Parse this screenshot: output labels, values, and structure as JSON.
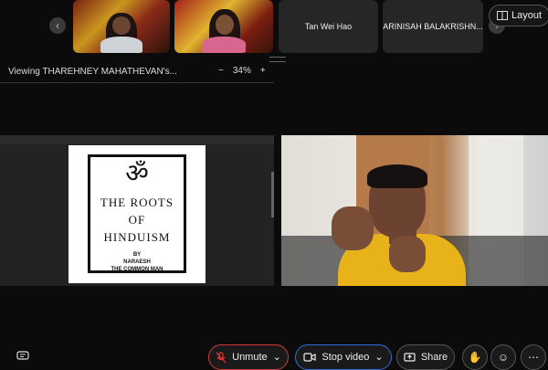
{
  "participants": {
    "tiles": [
      {
        "name": ""
      },
      {
        "name": ""
      },
      {
        "name": "Tan Wei Hao"
      },
      {
        "name": "ARINISAH BALAKRISHN..."
      }
    ],
    "prev_icon": "chevron-left-icon",
    "next_icon": "chevron-right-icon"
  },
  "layout_button": {
    "label": "Layout"
  },
  "viewing_bar": {
    "label": "Viewing THAREHNEY MAHATHEVAN's...",
    "zoom_out": "−",
    "zoom_level": "34%",
    "zoom_in": "+"
  },
  "shared_doc": {
    "symbol": "ॐ",
    "title_line1": "THE ROOTS",
    "title_line2": "OF",
    "title_line3": "HINDUISM",
    "by": "BY",
    "author": "NARAESH",
    "author_tag": "THE COMMON MAN"
  },
  "toolbar": {
    "chat_icon": "captions-icon",
    "unmute_label": "Unmute",
    "stop_video_label": "Stop video",
    "share_label": "Share",
    "colors": {
      "unmute_border": "#d13b3b",
      "video_border": "#2f6fd8"
    }
  }
}
